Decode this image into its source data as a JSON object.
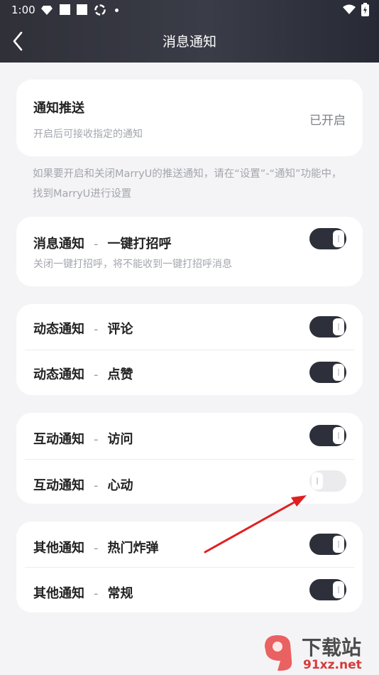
{
  "status_bar": {
    "time": "1:00"
  },
  "header": {
    "title": "消息通知"
  },
  "push": {
    "title": "通知推送",
    "subtitle": "开启后可接收指定的通知",
    "status": "已开启"
  },
  "hint": "如果要开启和关闭MarryU的推送通知，请在“设置”-“通知”功能中，找到MarryU进行设置",
  "greeting": {
    "label": "消息通知",
    "separator": "-",
    "sublabel": "一键打招呼",
    "description": "关闭一键打招呼，将不能收到一键打招呼消息",
    "on": true
  },
  "groups": [
    {
      "rows": [
        {
          "label": "动态通知",
          "separator": "-",
          "sublabel": "评论",
          "on": true
        },
        {
          "label": "动态通知",
          "separator": "-",
          "sublabel": "点赞",
          "on": true
        }
      ]
    },
    {
      "rows": [
        {
          "label": "互动通知",
          "separator": "-",
          "sublabel": "访问",
          "on": true
        },
        {
          "label": "互动通知",
          "separator": "-",
          "sublabel": "心动",
          "on": false
        }
      ]
    },
    {
      "rows": [
        {
          "label": "其他通知",
          "separator": "-",
          "sublabel": "热门炸弹",
          "on": true
        },
        {
          "label": "其他通知",
          "separator": "-",
          "sublabel": "常规",
          "on": true
        }
      ]
    }
  ],
  "watermark": {
    "text": "下载站",
    "url": "91xz.net"
  },
  "colors": {
    "header_bg": "#30323b",
    "toggle_on": "#2d303a",
    "toggle_off": "#ebebed",
    "arrow": "#e02020"
  }
}
